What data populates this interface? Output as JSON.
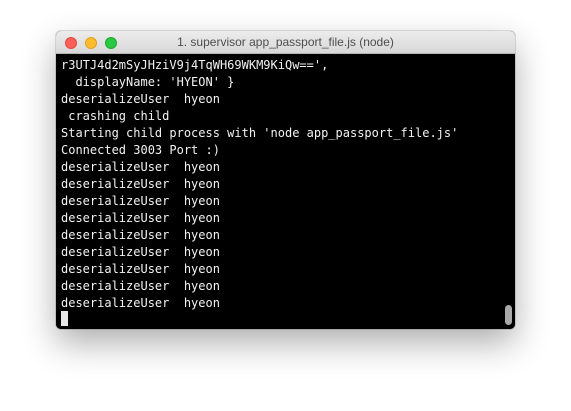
{
  "window": {
    "title": "1. supervisor app_passport_file.js (node)"
  },
  "terminal": {
    "lines": [
      "r3UTJ4d2mSyJHziV9j4TqWH69WKM9KiQw==',",
      "  displayName: 'HYEON' }",
      "deserializeUser  hyeon",
      " crashing child",
      "Starting child process with 'node app_passport_file.js'",
      "Connected 3003 Port :)",
      "deserializeUser  hyeon",
      "deserializeUser  hyeon",
      "deserializeUser  hyeon",
      "deserializeUser  hyeon",
      "deserializeUser  hyeon",
      "deserializeUser  hyeon",
      "deserializeUser  hyeon",
      "deserializeUser  hyeon",
      "deserializeUser  hyeon"
    ]
  },
  "colors": {
    "close": "#fc5f57",
    "minimize": "#fdbc2e",
    "maximize": "#28c840",
    "terminal_bg": "#000000",
    "terminal_fg": "#f2f2f2"
  }
}
